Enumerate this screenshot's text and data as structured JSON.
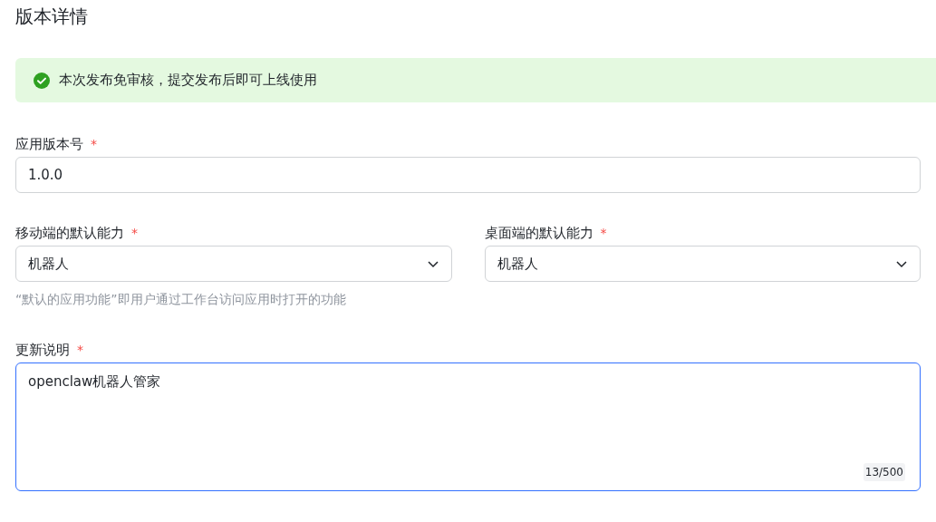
{
  "page": {
    "title": "版本详情"
  },
  "alert": {
    "kind": "success",
    "text": "本次发布免审核，提交发布后即可上线使用"
  },
  "version_field": {
    "label": "应用版本号",
    "required_mark": "*",
    "value": "1.0.0"
  },
  "capability_fields": [
    {
      "label": "移动端的默认能力",
      "required_mark": "*",
      "value": "机器人"
    },
    {
      "label": "桌面端的默认能力",
      "required_mark": "*",
      "value": "机器人"
    }
  ],
  "capability_help": "“默认的应用功能”即用户通过工作台访问应用时打开的功能",
  "notes_field": {
    "label": "更新说明",
    "required_mark": "*",
    "value": "openclaw机器人管家",
    "counter": "13/500",
    "focused": true
  }
}
